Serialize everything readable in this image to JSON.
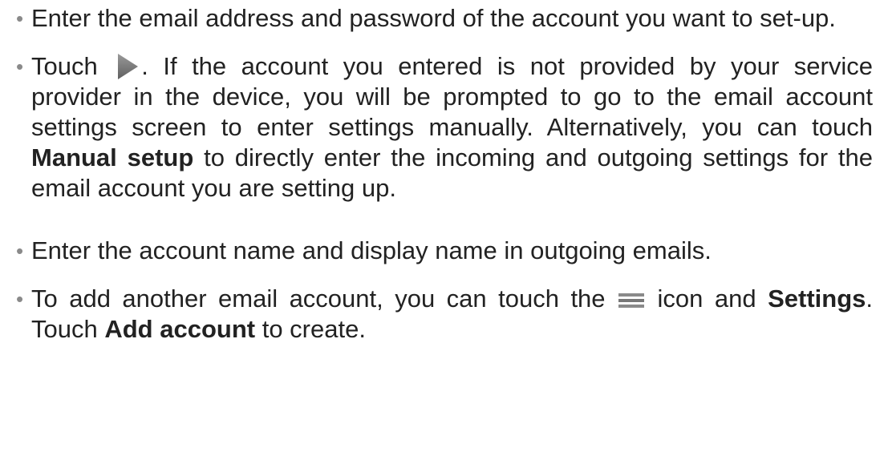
{
  "bullets": [
    {
      "text": "Enter the email address and password of the account you want to set-up."
    },
    {
      "pre": "Touch",
      "post_icon": ". If the account you entered is not provided by your service provider in the device, you will be prompted to go to the email account settings screen to enter settings manually. Alternatively, you can touch",
      "bold": "Manual setup",
      "post": "to directly enter the incoming and outgoing settings for the email account you are setting up.",
      "icon": "play-arrow-icon"
    },
    {
      "text": "Enter the account name and display name in outgoing emails."
    },
    {
      "pre": "To add another email account, you can touch the",
      "icon": "menu-icon",
      "mid": "icon and",
      "bold1": "Settings",
      "mid2": ". Touch",
      "bold2": "Add account",
      "post": "to create."
    }
  ],
  "colors": {
    "text": "#222222",
    "bullet": "#8a8a8a",
    "play_icon": "#777777",
    "menu_icon": "#777777"
  }
}
